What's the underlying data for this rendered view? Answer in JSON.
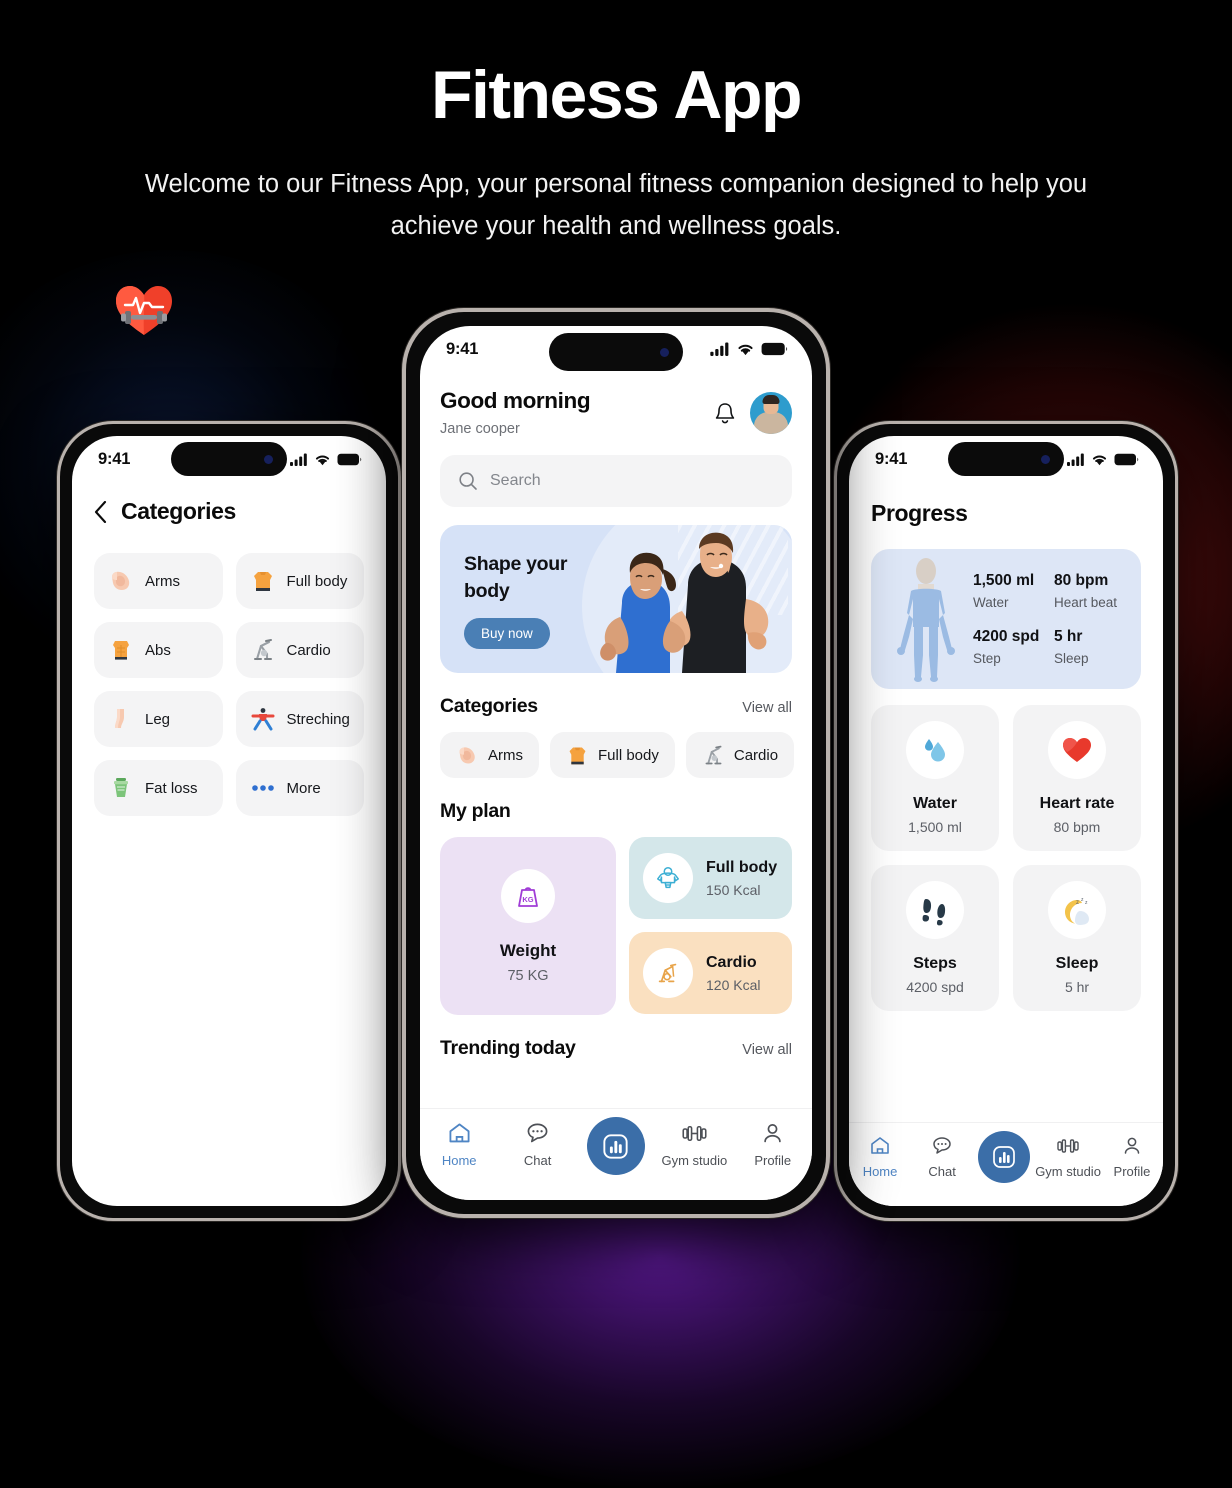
{
  "hero": {
    "title": "Fitness App",
    "subtitle": "Welcome to our Fitness App, your personal fitness companion designed to help you achieve your health and wellness goals."
  },
  "colors": {
    "accent_blue": "#3b6ea8",
    "nav_active": "#4f85c4",
    "banner_bg": "#d6e2f7",
    "weight_card": "#ece1f4",
    "fullbody_card": "#d4e7ea",
    "cardio_card": "#fae0c0",
    "card_grey": "#f3f3f4",
    "glow_red": "#781414",
    "glow_purple": "#56188c"
  },
  "decor": {
    "heart_dumbbell_icon": "heart-dumbbell-emoji"
  },
  "status_bar": {
    "time": "9:41",
    "icons": [
      "cellular-signal-icon",
      "wifi-icon",
      "battery-icon"
    ]
  },
  "phone_left": {
    "screen_name": "Categories",
    "back_icon": "chevron-left-icon",
    "title": "Categories",
    "categories": [
      {
        "label": "Arms",
        "icon": "flexed-biceps-emoji"
      },
      {
        "label": "Full body",
        "icon": "full-body-shirt-emoji"
      },
      {
        "label": "Abs",
        "icon": "abs-torso-emoji"
      },
      {
        "label": "Cardio",
        "icon": "exercise-bike-emoji"
      },
      {
        "label": "Leg",
        "icon": "leg-emoji"
      },
      {
        "label": "Streching",
        "icon": "stretching-person-emoji"
      },
      {
        "label": "Fat loss",
        "icon": "fat-loss-scale-emoji"
      },
      {
        "label": "More",
        "icon": "three-dots-icon"
      }
    ]
  },
  "phone_center": {
    "screen_name": "Home",
    "header": {
      "greeting": "Good morning",
      "user_name": "Jane cooper",
      "bell_icon": "notification-bell-icon",
      "avatar_icon": "user-avatar"
    },
    "search": {
      "placeholder": "Search",
      "icon": "search-icon"
    },
    "banner": {
      "title": "Shape your body",
      "button_label": "Buy now",
      "image": "fitness-couple-photo"
    },
    "categories_section": {
      "title": "Categories",
      "view_all": "View all",
      "chips": [
        {
          "label": "Arms",
          "icon": "flexed-biceps-emoji"
        },
        {
          "label": "Full body",
          "icon": "full-body-shirt-emoji"
        },
        {
          "label": "Cardio",
          "icon": "exercise-bike-emoji"
        }
      ]
    },
    "my_plan": {
      "title": "My plan",
      "weight_card": {
        "title": "Weight",
        "value": "75 KG",
        "icon": "kg-weight-icon"
      },
      "small_cards": [
        {
          "title": "Full body",
          "value": "150 Kcal",
          "icon": "full-body-muscle-icon"
        },
        {
          "title": "Cardio",
          "value": "120 Kcal",
          "icon": "exercise-bike-icon"
        }
      ]
    },
    "trending": {
      "title": "Trending today",
      "view_all": "View all"
    },
    "bottom_nav": [
      {
        "label": "Home",
        "icon": "home-icon",
        "active": true
      },
      {
        "label": "Chat",
        "icon": "chat-bubble-icon",
        "active": false
      },
      {
        "label": "",
        "icon": "stats-chart-icon",
        "active": false
      },
      {
        "label": "Gym studio",
        "icon": "dumbbell-icon",
        "active": false
      },
      {
        "label": "Profile",
        "icon": "person-icon",
        "active": false
      }
    ]
  },
  "phone_right": {
    "screen_name": "Progress",
    "title": "Progress",
    "body_card": {
      "figure_icon": "human-body-silhouette",
      "stats": [
        {
          "value": "1,500 ml",
          "label": "Water"
        },
        {
          "value": "80 bpm",
          "label": "Heart beat"
        },
        {
          "value": "4200 spd",
          "label": "Step"
        },
        {
          "value": "5 hr",
          "label": "Sleep"
        }
      ]
    },
    "metrics": [
      {
        "title": "Water",
        "value": "1,500 ml",
        "icon": "water-drop-emoji"
      },
      {
        "title": "Heart rate",
        "value": "80 bpm",
        "icon": "red-heart-emoji"
      },
      {
        "title": "Steps",
        "value": "4200 spd",
        "icon": "footprints-emoji"
      },
      {
        "title": "Sleep",
        "value": "5 hr",
        "icon": "sleeping-moon-emoji"
      }
    ],
    "bottom_nav": [
      {
        "label": "Home",
        "icon": "home-icon",
        "active": true
      },
      {
        "label": "Chat",
        "icon": "chat-bubble-icon",
        "active": false
      },
      {
        "label": "",
        "icon": "stats-chart-icon",
        "active": false
      },
      {
        "label": "Gym studio",
        "icon": "dumbbell-icon",
        "active": false
      },
      {
        "label": "Profile",
        "icon": "person-icon",
        "active": false
      }
    ]
  }
}
